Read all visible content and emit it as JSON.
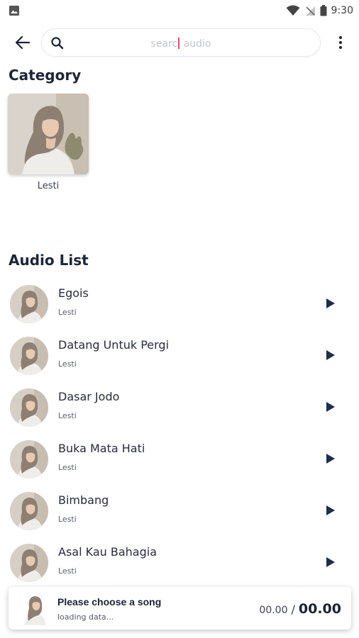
{
  "status_bar": {
    "time": "9:30"
  },
  "search": {
    "placeholder_before": "searc",
    "placeholder_after": " audio"
  },
  "category": {
    "title": "Category",
    "items": [
      {
        "label": "Lesti"
      }
    ]
  },
  "audio_list": {
    "title": "Audio List",
    "songs": [
      {
        "title": "Egois",
        "artist": "Lesti"
      },
      {
        "title": "Datang Untuk Pergi",
        "artist": "Lesti"
      },
      {
        "title": "Dasar Jodo",
        "artist": "Lesti"
      },
      {
        "title": "Buka Mata Hati",
        "artist": "Lesti"
      },
      {
        "title": "Bimbang",
        "artist": "Lesti"
      },
      {
        "title": "Asal Kau Bahagia",
        "artist": "Lesti"
      }
    ]
  },
  "player": {
    "title": "Please choose a song",
    "subtitle": "loading data...",
    "current_time": "00.00",
    "separator": "/",
    "total_time": "00.00"
  },
  "colors": {
    "accent_caret": "#e8476b",
    "play_icon": "#1f2c4a",
    "heading": "#1d2538"
  }
}
